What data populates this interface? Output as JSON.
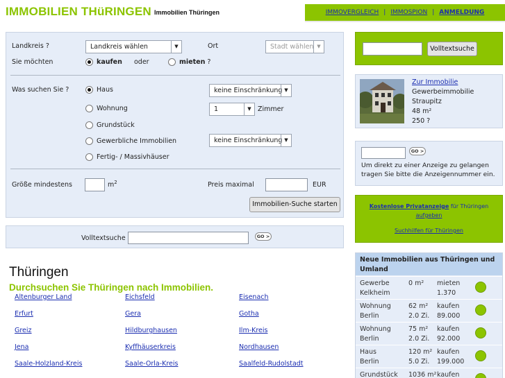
{
  "header": {
    "logo": "IMMOBILIEN THüRINGEN",
    "subtitle": "Immobilien Thüringen",
    "nav": [
      "IMMOVERGLEICH",
      "IMMOSPION",
      "ANMELDUNG"
    ],
    "nav_sep": "|"
  },
  "search": {
    "landkreis_label": "Landkreis ?",
    "landkreis_value": "Landkreis wählen",
    "ort_label": "Ort",
    "ort_value": "Stadt wählen",
    "moechten_label": "Sie möchten",
    "kaufen_label": "kaufen",
    "oder_label": "oder",
    "mieten_label": "mieten",
    "mieten_q": "?",
    "was_label": "Was suchen Sie ?",
    "types": [
      "Haus",
      "Wohnung",
      "Grundstück",
      "Gewerbliche Immobilien",
      "Fertig- / Massivhäuser"
    ],
    "haus_select": "keine Einschränkung",
    "zimmer_value": "1",
    "zimmer_label": "Zimmer",
    "gewerbe_select": "keine Einschränkung",
    "groesse_label": "Größe mindestens",
    "groesse_unit": "m",
    "groesse_sup": "2",
    "preis_label": "Preis maximal",
    "preis_unit": "EUR",
    "submit_label": "Immobilien-Suche starten"
  },
  "volltext": {
    "label": "Volltextsuche",
    "go_label": "GO >"
  },
  "main": {
    "title": "Thüringen",
    "subtitle": "Durchsuchen Sie Thüringen nach Immobilien.",
    "regions": [
      [
        "Altenburger Land",
        "Eichsfeld",
        "Eisenach"
      ],
      [
        "Erfurt",
        "Gera",
        "Gotha"
      ],
      [
        "Greiz",
        "Hildburghausen",
        "Ilm-Kreis"
      ],
      [
        "Jena",
        "Kyffhäuserkreis",
        "Nordhausen"
      ],
      [
        "Saale-Holzland-Kreis",
        "Saale-Orla-Kreis",
        "Saalfeld-Rudolstadt"
      ]
    ]
  },
  "sidebar": {
    "volltext_button": "Volltextsuche",
    "featured": {
      "link": "Zur Immobilie",
      "type": "Gewerbeimmobilie",
      "place": "Straupitz",
      "size": "48 m²",
      "price": "250 ?"
    },
    "number": {
      "go_label": "GO >",
      "text": "Um direkt zu einer Anzeige zu gelangen tragen Sie bitte die Anzeigennummer ein."
    },
    "private": {
      "link1": "Kostenlose Privatanzeige",
      "text1": " für Thüringen",
      "link2": "aufgeben",
      "link3": "Suchhilfen für Thüringen"
    },
    "new_listings": {
      "title": "Neue Immobilien aus Thüringen und Umland",
      "rows": [
        {
          "type": "Gewerbe",
          "city": "Kelkheim",
          "size": "0 m²",
          "rooms": "",
          "mode": "mieten",
          "price": "1.370"
        },
        {
          "type": "Wohnung",
          "city": "Berlin",
          "size": "62 m²",
          "rooms": "2.0 Zi.",
          "mode": "kaufen",
          "price": "89.000"
        },
        {
          "type": "Wohnung",
          "city": "Berlin",
          "size": "75 m²",
          "rooms": "2.0 Zi.",
          "mode": "kaufen",
          "price": "92.000"
        },
        {
          "type": "Haus",
          "city": "Berlin",
          "size": "120 m²",
          "rooms": "5.0 Zi.",
          "mode": "kaufen",
          "price": "199.000"
        },
        {
          "type": "Grundstück",
          "city": "",
          "size": "1036 m²",
          "rooms": "",
          "mode": "kaufen",
          "price": ""
        }
      ]
    }
  },
  "colors": {
    "accent": "#8cc400",
    "panel": "#e6edf8",
    "link": "#1a2db0"
  }
}
